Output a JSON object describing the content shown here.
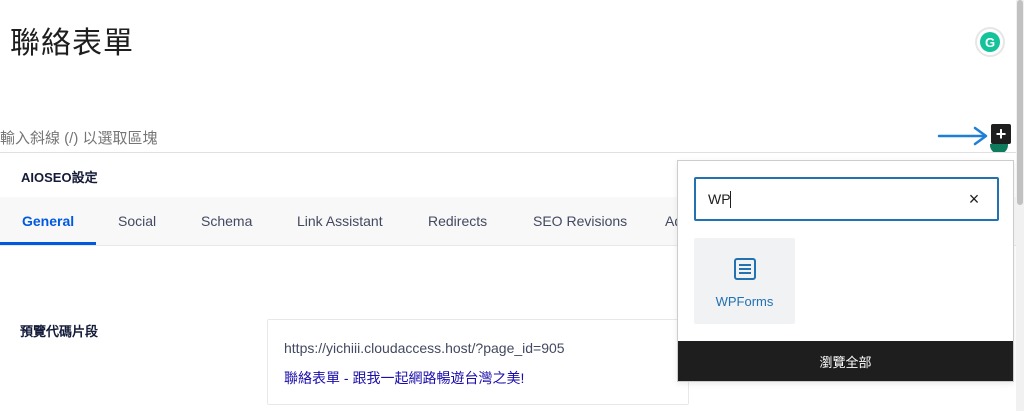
{
  "editor": {
    "post_title": "聯絡表單",
    "block_placeholder": "輸入斜線 (/) 以選取區塊",
    "grammarly_icon": "G"
  },
  "inserter_toggle": {
    "glyph": "+"
  },
  "aioseo": {
    "section_title": "AIOSEO設定",
    "tabs": [
      {
        "label": "General",
        "active": true
      },
      {
        "label": "Social"
      },
      {
        "label": "Schema"
      },
      {
        "label": "Link Assistant"
      },
      {
        "label": "Redirects"
      },
      {
        "label": "SEO Revisions"
      },
      {
        "label": "Ad"
      }
    ],
    "snippet": {
      "label": "預覽代碼片段",
      "url": "https://yichiii.cloudaccess.host/?page_id=905",
      "title": "聯絡表單 - 跟我一起網路暢遊台灣之美!"
    }
  },
  "inserter": {
    "search_value": "WP",
    "clear_glyph": "×",
    "results": [
      {
        "label": "WPForms",
        "icon": "wpforms-icon"
      }
    ],
    "browse_all_label": "瀏覽全部"
  },
  "colors": {
    "accent": "#2271b1",
    "tab_active": "#005ae0",
    "annotation_arrow": "#1f7fd6",
    "dark": "#1e1e1e"
  }
}
